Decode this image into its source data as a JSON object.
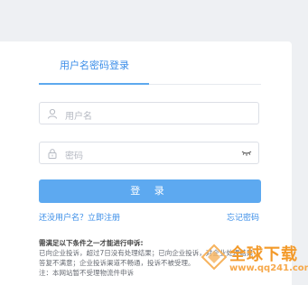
{
  "login": {
    "tab_title": "用户名密码登录",
    "username_placeholder": "用户名",
    "password_placeholder": "密码",
    "submit_label": "登 录",
    "register_link": "还没用户名？立即注册",
    "forgot_link": "忘记密码"
  },
  "notice": {
    "heading": "需满足以下条件之一才能进行申诉:",
    "lines": [
      "已向企业投诉，超过7日没有处理结果；已向企业投诉，对企业处理结果",
      "答复不满意；企业投诉渠道不畅通，投诉不被受理。",
      "注：本网站暂不受理物流件申诉"
    ]
  },
  "watermark": {
    "title": "全球下载",
    "url": "www.qq241.com"
  }
}
